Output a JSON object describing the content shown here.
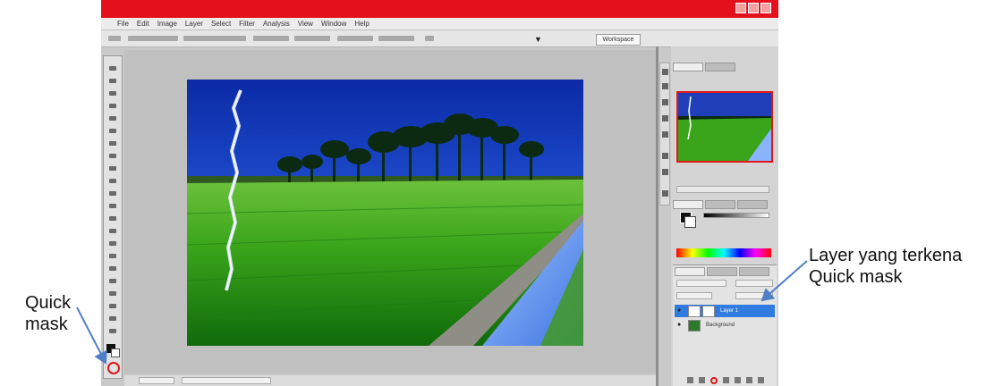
{
  "app": {
    "title": "",
    "menu": [
      "File",
      "Edit",
      "Image",
      "Layer",
      "Select",
      "Filter",
      "Analysis",
      "View",
      "Window",
      "Help"
    ],
    "workspace_button": "Workspace"
  },
  "layers_panel": {
    "layers": [
      {
        "name": "Layer 1",
        "selected": true
      },
      {
        "name": "Background",
        "selected": false
      }
    ]
  },
  "annotations": {
    "left_label_line1": "Quick",
    "left_label_line2": "mask",
    "right_label_line1": "Layer yang terkena",
    "right_label_line2": "Quick mask"
  },
  "colors": {
    "titlebar": "#e4111c",
    "highlight_circle": "#d81818",
    "arrow": "#4f7fc6",
    "selected_layer": "#2f7be0",
    "sky_top": "#0b2aa6",
    "field_green": "#3aa51b"
  },
  "icons": [
    "lightning-bolt",
    "palm-trees",
    "rice-field",
    "water-canal",
    "eye-icon",
    "quick-mask-icon",
    "add-mask-icon"
  ]
}
